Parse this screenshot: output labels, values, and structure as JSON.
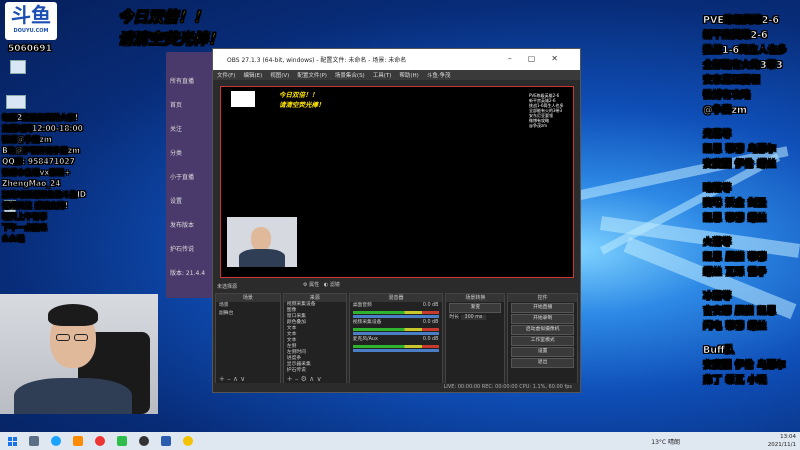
{
  "overlay": {
    "banner_line1": "今日双倍！！",
    "banner_line2": "请清空荧光棒！",
    "site_logo_text": "斗鱼",
    "site_logo_sub": "DOUYU.COM",
    "room_id": "5060691",
    "left_info": [
      "每日2星任务拜托大家!",
      "直播时间12:00-18:00",
      "微博@争茂zm",
      "B站@护石传说争茂zm",
      "QQ群: 958471027",
      "微博本名请vx群进+",
      "ZhengMao_24",
      "加的时候记得备注斗鱼ID",
      "记得关注 感谢支持!",
      "明天上午有事",
      "下午一点前来",
      "么么哒"
    ],
    "right_info": [
      "PVE练级英雄2-6",
      "新平房英雄2-6",
      "挑战1-6简生人也多",
      "全部能有火的3带3",
      "安东尼亚要领",
      "微博有攻略",
      "@争茂zm"
    ],
    "groups": [
      {
        "title": "光落尊",
        "lines": [
          "凯恩 蒂穆 乌瑟尔",
          "安度因 伊伦 螺丝"
        ]
      },
      {
        "title": "暗落尊",
        "lines": [
          "赛琳 沃金 剑圣",
          "凯恩 蒂穆 螺丝"
        ]
      },
      {
        "title": "火落尊",
        "lines": [
          "凯恩 晨猫 蒂穆",
          "螺丝 瓦砾 雷矛"
        ]
      },
      {
        "title": "冰落尊",
        "lines": [
          "吉安娜 晨猫 凯恩",
          "闪电 蒂穆 螺丝"
        ]
      },
      {
        "title": "Buff队",
        "lines": [
          "安度因 伊伦 乌瑟尔",
          "弗丁 希瓦 小玩"
        ]
      }
    ]
  },
  "bg_window": {
    "rows": [
      "所有直播",
      "首页",
      "关注",
      "分类",
      "小于直播",
      "设置",
      "发布版本",
      "护石传说",
      "版本: 21.4.4"
    ]
  },
  "obs": {
    "title": "OBS 27.1.3 (64-bit, windows) - 配置文件: 未命名 - 场景: 未命名",
    "menu": [
      "文件(F)",
      "编辑(E)",
      "视图(V)",
      "配置文件(P)",
      "场景集合(S)",
      "工具(T)",
      "帮助(H)",
      "斗鱼·争茂"
    ],
    "no_source": "未选择源",
    "props_label": "属性",
    "filters_label": "滤镜",
    "docks": {
      "scenes": {
        "header": "场景",
        "items": [
          "场景",
          "副舞台"
        ]
      },
      "sources": {
        "header": "来源",
        "items": [
          "视频采集设备",
          "图像",
          "窗口采集",
          "颜色叠加",
          "文本",
          "文本",
          "文本",
          "左侧",
          "左侧时间",
          "进度条",
          "显示器采集",
          "护石传说"
        ]
      },
      "mixer": {
        "header": "混音器",
        "tracks": [
          {
            "name": "桌面音频",
            "db": "0.0 dB"
          },
          {
            "name": "视频采集设备",
            "db": "0.0 dB"
          },
          {
            "name": "麦克风/Aux",
            "db": "0.0 dB"
          }
        ]
      },
      "transitions": {
        "header": "场景转换",
        "type": "渐变",
        "duration_label": "时长",
        "duration": "300 ms"
      },
      "controls": {
        "header": "控件",
        "buttons": [
          "开始直播",
          "开始录制",
          "启动虚拟摄像机",
          "工作室模式",
          "设置",
          "退出"
        ]
      }
    },
    "status": "LIVE: 00:00:00   REC: 00:00:00   CPU: 1.1%, 60.00 fps"
  },
  "preview": {
    "banner_line1": "今日双倍！！",
    "banner_line2": "请清空荧光棒！",
    "right_list": [
      "PVE练级英雄2-6",
      "新平房英雄2-6",
      "挑战1-6简生人也多",
      "全部能有火的3带3",
      "安东尼亚要领",
      "微博有攻略",
      "@争茂zm"
    ]
  },
  "taskbar": {
    "weather": "13°C 晴朗",
    "time": "13:04",
    "date": "2021/11/1"
  }
}
